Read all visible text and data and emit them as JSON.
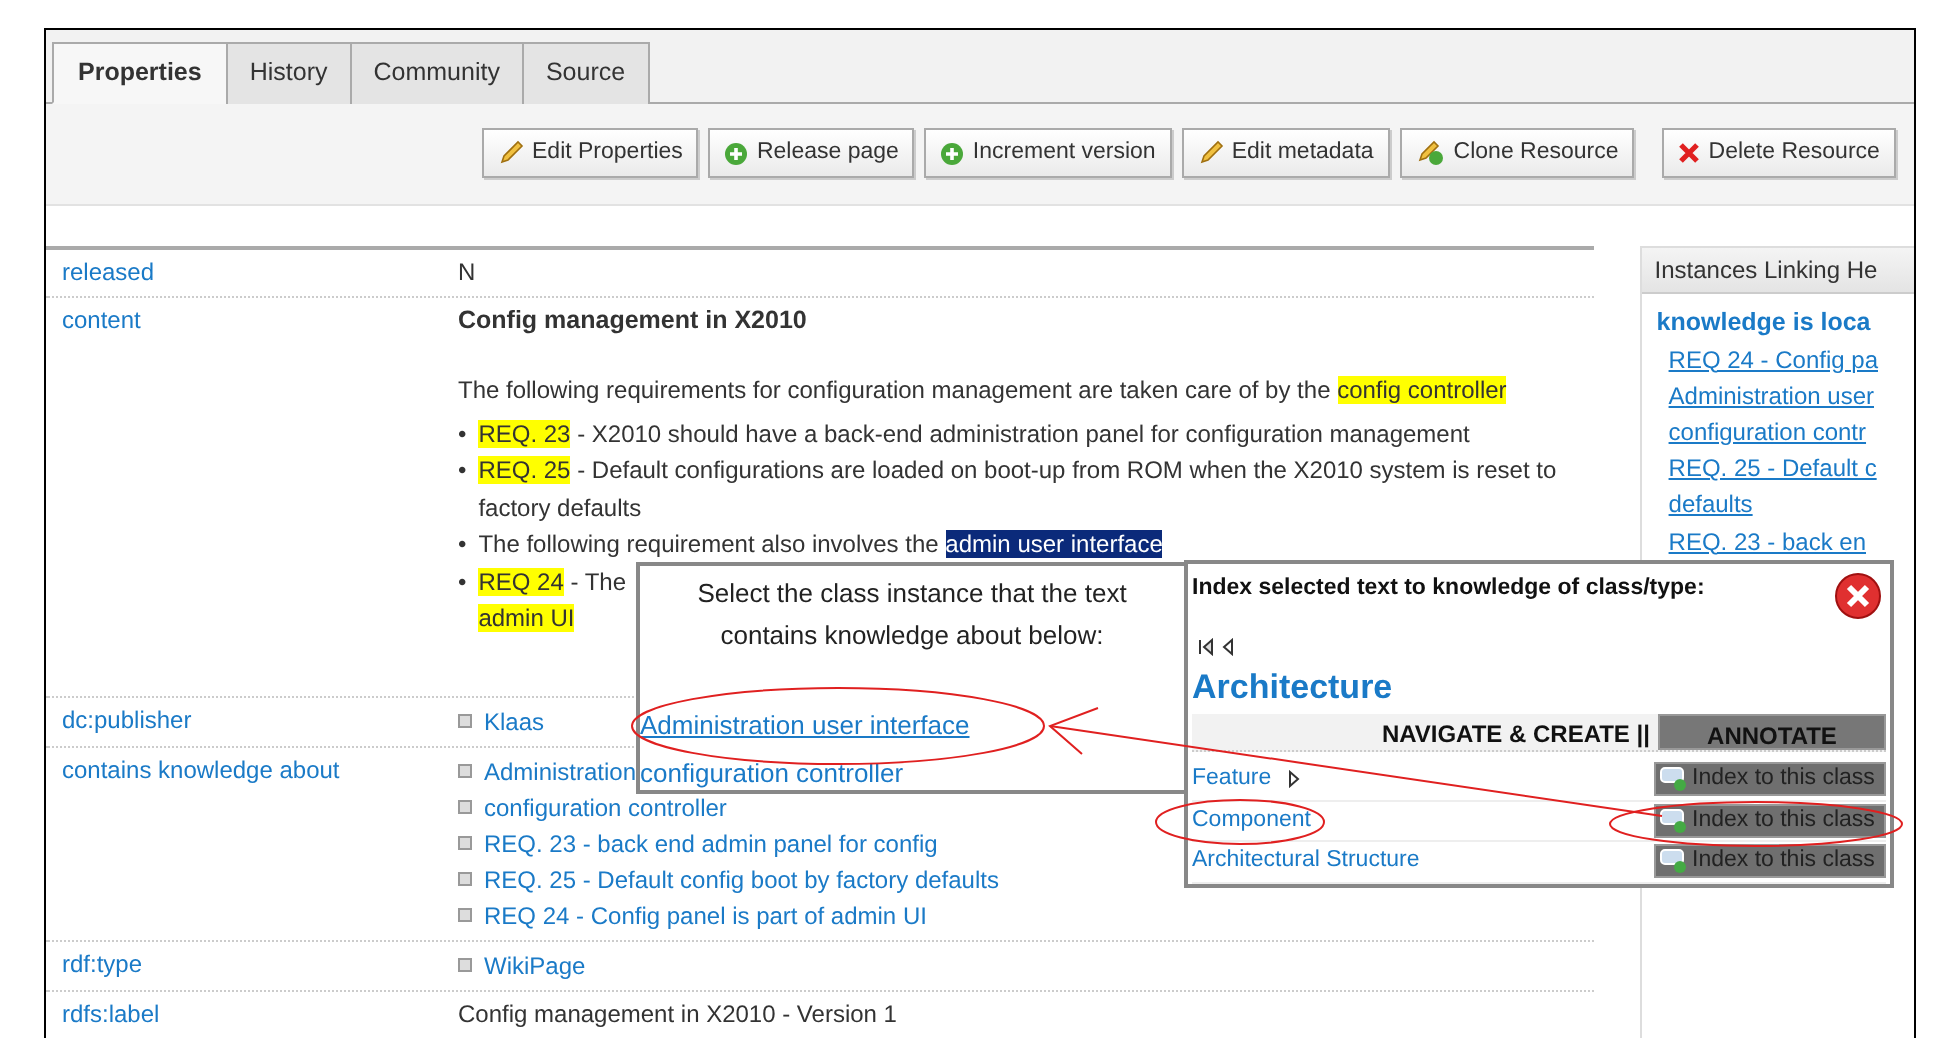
{
  "tabs": [
    {
      "label": "Properties",
      "selected": true
    },
    {
      "label": "History",
      "selected": false
    },
    {
      "label": "Community",
      "selected": false
    },
    {
      "label": "Source",
      "selected": false
    }
  ],
  "toolbar": {
    "buttons": [
      {
        "label": "Edit Properties",
        "kind": "edit"
      },
      {
        "label": "Release page",
        "kind": "add"
      },
      {
        "label": "Increment version",
        "kind": "add"
      },
      {
        "label": "Edit metadata",
        "kind": "edit"
      },
      {
        "label": "Clone Resource",
        "kind": "clone"
      },
      {
        "label": "Delete Resource",
        "kind": "delete"
      }
    ]
  },
  "properties": [
    {
      "label": "released",
      "kind": "text",
      "value": "N"
    },
    {
      "label": "content",
      "kind": "content",
      "title": "Config management in X2010",
      "intro": [
        {
          "text": "The following requirements for configuration management are taken care of by the ",
          "highlighted": false
        },
        {
          "text": "config controller",
          "highlighted": true
        }
      ],
      "bullets": [
        {
          "marker": "•",
          "parts": [
            {
              "text": "REQ. 23",
              "highlighted": true
            },
            {
              "text": " -  X2010 should have a back-end administration panel for configuration management",
              "highlighted": false
            }
          ]
        },
        {
          "marker": "•",
          "parts": [
            {
              "text": "REQ. 25",
              "highlighted": true
            },
            {
              "text": " - Default configurations are loaded on boot-up from ROM when the X2010 system is reset to factory defaults",
              "highlighted": false
            }
          ]
        },
        {
          "marker": "•",
          "parts": [
            {
              "text": "The following requirement also involves the ",
              "highlighted": false
            },
            {
              "text": "admin user interface",
              "highlighted": false,
              "selected": true
            }
          ]
        },
        {
          "marker": "•",
          "parts": [
            {
              "text": "REQ 24",
              "highlighted": true
            },
            {
              "text": " - The",
              "highlighted": false
            }
          ],
          "second_line": [
            {
              "text": "admin UI",
              "highlighted": true
            }
          ]
        }
      ]
    },
    {
      "label": "dc:publisher",
      "kind": "links",
      "links": [
        "Klaas"
      ]
    },
    {
      "label": "contains knowledge about",
      "kind": "links",
      "links": [
        "Administration",
        "configuration controller",
        "REQ. 23 - back end admin panel for config",
        "REQ. 25 - Default config boot by factory defaults",
        "REQ 24 - Config panel is part of admin UI"
      ]
    },
    {
      "label": "rdf:type",
      "kind": "links",
      "links": [
        "WikiPage"
      ]
    },
    {
      "label": "rdfs:label",
      "kind": "text",
      "value": "Config management in X2010 - Version 1"
    }
  ],
  "sidebar": {
    "title": "Instances Linking He",
    "heading": "knowledge is loca",
    "links": [
      "REQ 24 - Config pa",
      "Administration user",
      "configuration contr",
      "REQ. 25 - Default c",
      "defaults",
      "REQ. 23 - back en"
    ]
  },
  "select_dialog": {
    "prompt": "Select the class instance that the text contains knowledge about below:",
    "options": [
      {
        "label": "Administration user interface",
        "selected": true
      },
      {
        "label": "configuration controller",
        "selected": false
      }
    ]
  },
  "index_dialog": {
    "title": "Index selected text to knowledge of class/type:",
    "heading": "Architecture",
    "tabs": [
      {
        "label": "NAVIGATE & CREATE ||",
        "selected": false
      },
      {
        "label": "ANNOTATE",
        "selected": true
      }
    ],
    "rows": [
      {
        "name": "Feature",
        "expandable": true,
        "action": "Index to this class"
      },
      {
        "name": "Component",
        "expandable": false,
        "action": "Index to this class"
      },
      {
        "name": "Architectural Structure",
        "expandable": false,
        "action": "Index to this class"
      }
    ]
  }
}
